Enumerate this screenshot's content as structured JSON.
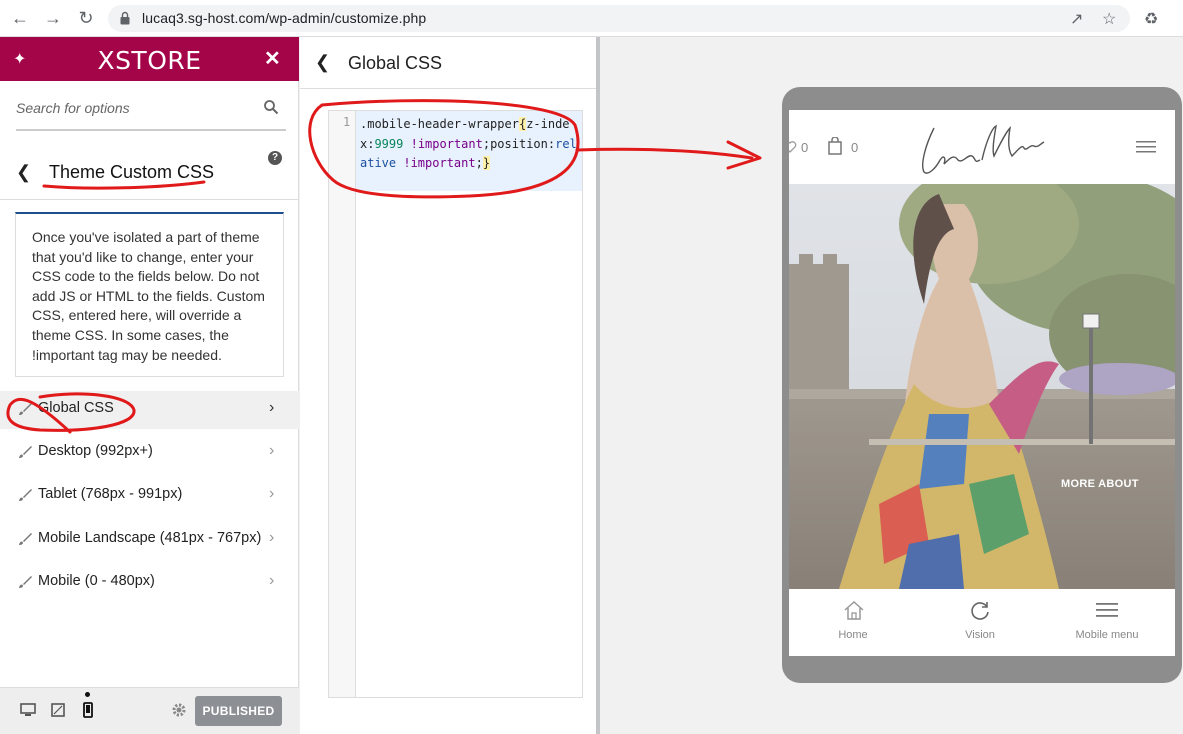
{
  "browser": {
    "url": "lucaq3.sg-host.com/wp-admin/customize.php"
  },
  "sidebar": {
    "brand": "XSTORE",
    "search_placeholder": "Search for options",
    "section_title": "Theme Custom CSS",
    "description": "Once you've isolated a part of theme that you'd like to change, enter your CSS code to the fields below. Do not add JS or HTML to the fields. Custom CSS, entered here, will override a theme CSS. In some cases, the !important tag may be needed.",
    "items": [
      {
        "label": "Global CSS"
      },
      {
        "label": "Desktop (992px+)"
      },
      {
        "label": "Tablet (768px - 991px)"
      },
      {
        "label": "Mobile Landscape (481px - 767px)"
      },
      {
        "label": "Mobile (0 - 480px)"
      }
    ],
    "published_label": "PUBLISHED"
  },
  "css_panel": {
    "title": "Global CSS",
    "line_number": "1",
    "code": {
      "selector": ".mobile-header-wrapper",
      "open": "{",
      "prop1": "z-index:",
      "val1": "9999",
      "imp1": "!important",
      "semi1": ";",
      "prop2": "position:",
      "val2": "relative",
      "imp2": "!important",
      "semi2": ";",
      "close": "}"
    }
  },
  "preview": {
    "wishlist_count": "0",
    "cart_count": "0",
    "more_about": "MORE ABOUT",
    "bottom_nav": [
      {
        "label": "Home"
      },
      {
        "label": "Vision"
      },
      {
        "label": "Mobile menu"
      }
    ]
  },
  "colors": {
    "brand": "#a40549",
    "annotation": "#e01a1a"
  }
}
